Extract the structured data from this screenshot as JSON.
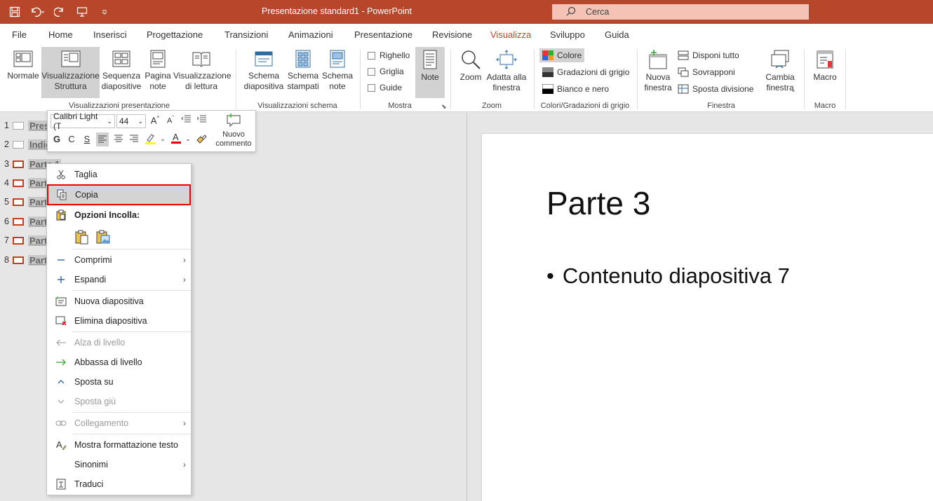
{
  "titlebar": {
    "title": "Presentazione standard1  -  PowerPoint",
    "search_placeholder": "Cerca"
  },
  "menu_tabs": [
    "File",
    "Home",
    "Inserisci",
    "Progettazione",
    "Transizioni",
    "Animazioni",
    "Presentazione",
    "Revisione",
    "Visualizza",
    "Sviluppo",
    "Guida"
  ],
  "active_tab": "Visualizza",
  "ribbon": {
    "views": {
      "normale": "Normale",
      "struttura": [
        "Visualizzazione",
        "Struttura"
      ],
      "sequenza": [
        "Sequenza",
        "diapositive"
      ],
      "pagina_note": [
        "Pagina",
        "note"
      ],
      "lettura": [
        "Visualizzazione",
        "di lettura"
      ],
      "group": "Visualizzazioni presentazione"
    },
    "master": {
      "schema_diapositiva": [
        "Schema",
        "diapositiva"
      ],
      "schema_stampati": [
        "Schema",
        "stampati"
      ],
      "schema_note": [
        "Schema",
        "note"
      ],
      "group": "Visualizzazioni schema"
    },
    "mostra": {
      "righello": "Righello",
      "griglia": "Griglia",
      "guide": "Guide",
      "note": "Note",
      "group": "Mostra"
    },
    "zoom": {
      "zoom": "Zoom",
      "adatta": [
        "Adatta alla",
        "finestra"
      ],
      "group": "Zoom"
    },
    "colori": {
      "colore": "Colore",
      "grigio": "Gradazioni di grigio",
      "bianco_nero": "Bianco e nero",
      "group": "Colori/Gradazioni di grigio"
    },
    "finestra": {
      "nuova": [
        "Nuova",
        "finestra"
      ],
      "disponi": "Disponi tutto",
      "sovrapponi": "Sovrapponi",
      "sposta": "Sposta divisione",
      "cambia": [
        "Cambia",
        "finestra"
      ],
      "group": "Finestra"
    },
    "macro": {
      "macro": "Macro",
      "group": "Macro"
    }
  },
  "outline": [
    {
      "num": "1",
      "text": "Prese"
    },
    {
      "num": "2",
      "text": "Indic"
    },
    {
      "num": "3",
      "text": "Parte 1"
    },
    {
      "num": "4",
      "text": "Parte"
    },
    {
      "num": "5",
      "text": "Parte"
    },
    {
      "num": "6",
      "text": "Parte"
    },
    {
      "num": "7",
      "text": "Parte"
    },
    {
      "num": "8",
      "text": "Parte"
    }
  ],
  "minitoolbar": {
    "font": "Calibri Light (T",
    "size": "44",
    "bold": "G",
    "italic": "C",
    "underline": "S",
    "comment": [
      "Nuovo",
      "commento"
    ]
  },
  "context_menu": {
    "taglia": "Taglia",
    "copia": "Copia",
    "opzioni_incolla": "Opzioni Incolla:",
    "comprimi": "Comprimi",
    "espandi": "Espandi",
    "nuova_diapositiva": "Nuova diapositiva",
    "elimina_diapositiva": "Elimina diapositiva",
    "alza_livello": "Alza di livello",
    "abbassa_livello": "Abbassa di livello",
    "sposta_su": "Sposta su",
    "sposta_giu": "Sposta giù",
    "collegamento": "Collegamento",
    "mostra_formattazione": "Mostra formattazione testo",
    "sinonimi": "Sinonimi",
    "traduci": "Traduci"
  },
  "slide": {
    "title": "Parte 3",
    "bullet": "Contenuto diapositiva 7"
  },
  "colors": {
    "accent": "#b7472a",
    "highlight_border": "#e00000"
  }
}
